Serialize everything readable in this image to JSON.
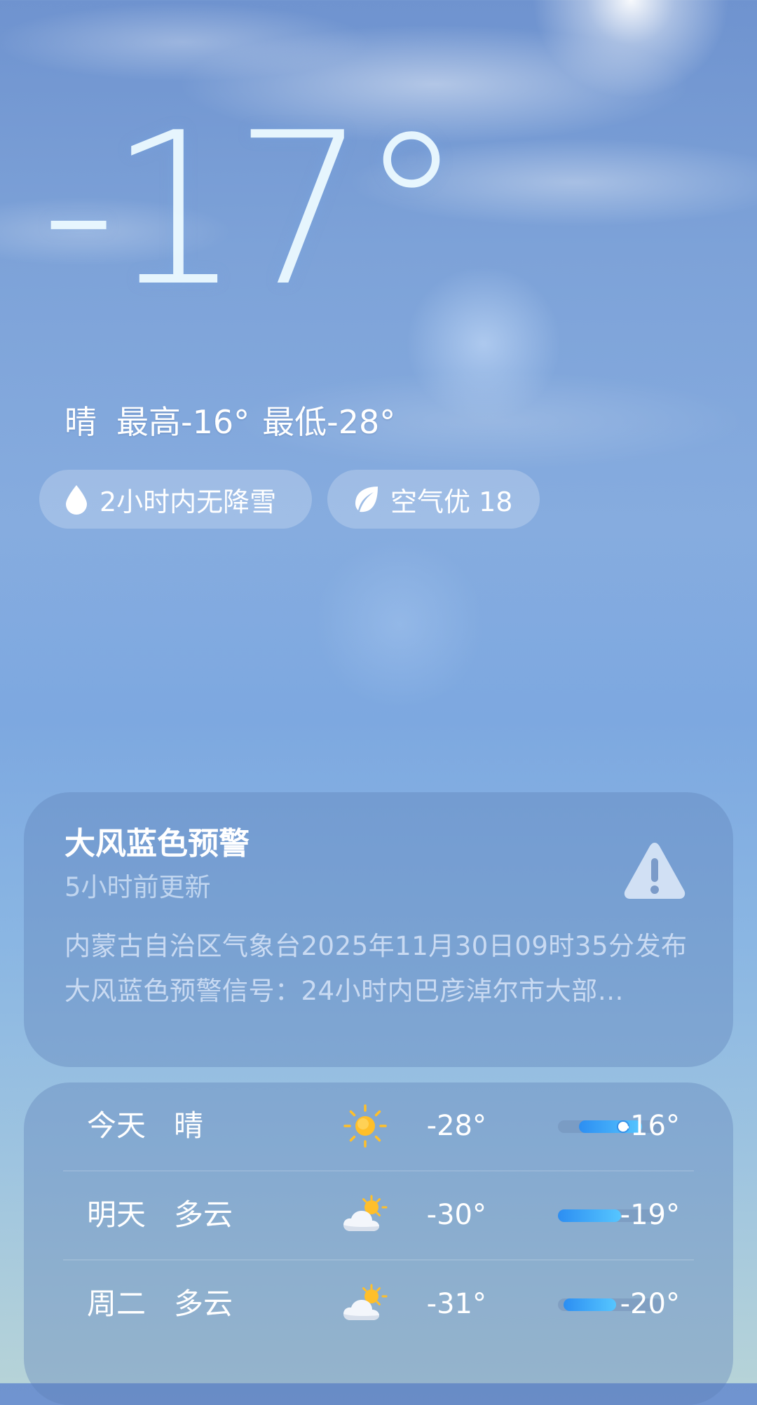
{
  "current": {
    "temperature": "-17°",
    "condition": "晴",
    "high": "最高-16°",
    "low": "最低-28°"
  },
  "chips": {
    "precip": "2小时内无降雪",
    "air": "空气优 18"
  },
  "alert": {
    "title": "大风蓝色预警",
    "updated": "5小时前更新",
    "body": "内蒙古自治区气象台2025年11月30日09时35分发布大风蓝色预警信号：24小时内巴彦淖尔市大部…",
    "icon": "warning-triangle-icon"
  },
  "forecast": [
    {
      "day": "今天",
      "condition": "晴",
      "icon": "sun-icon",
      "low": "-28°",
      "high": "-16°",
      "range_start": 0.2,
      "range_end": 0.8,
      "current_position": 0.62
    },
    {
      "day": "明天",
      "condition": "多云",
      "icon": "partly-cloudy-icon",
      "low": "-30°",
      "high": "-19°",
      "range_start": 0.0,
      "range_end": 0.6
    },
    {
      "day": "周二",
      "condition": "多云",
      "icon": "partly-cloudy-icon",
      "low": "-31°",
      "high": "-20°",
      "range_start": 0.05,
      "range_end": 0.55
    }
  ],
  "colors": {
    "bar_fill_start": "#2c8ef2",
    "bar_fill_end": "#56c6ff",
    "sun": "#ffbf2a"
  }
}
